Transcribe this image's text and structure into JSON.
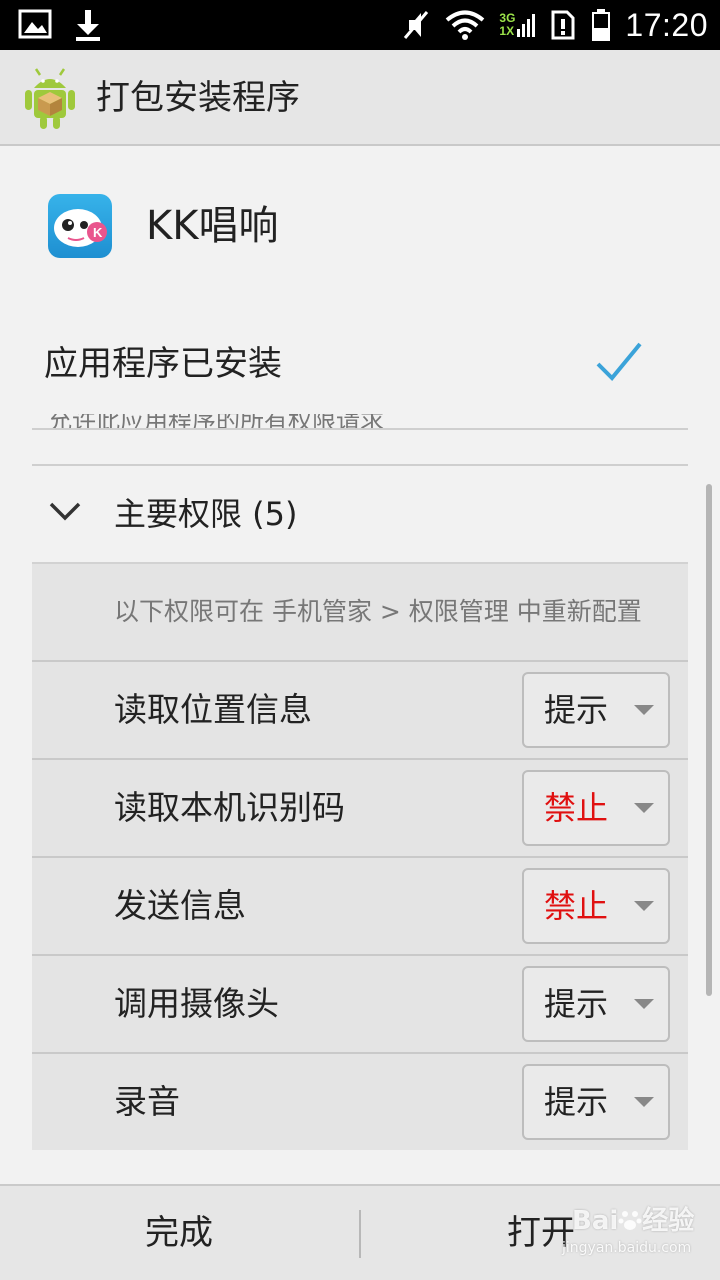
{
  "status_bar": {
    "time": "17:20",
    "network_top": "3G",
    "network_bottom": "1X",
    "icons": [
      "image-icon",
      "download-icon",
      "mute-icon",
      "wifi-icon",
      "signal-icon",
      "sim-alert-icon",
      "battery-icon"
    ]
  },
  "titlebar": {
    "title": "打包安装程序",
    "icon": "android-icon"
  },
  "app": {
    "name": "KK唱响",
    "icon": "kk-app-icon"
  },
  "install_status": {
    "text": "应用程序已安装",
    "icon": "checkmark-icon",
    "accent": "#3ba3d9"
  },
  "faded_text": "允许此应用程序的所有权限请求",
  "permissions": {
    "header": "主要权限 (5)",
    "note": "以下权限可在 手机管家 > 权限管理 中重新配置",
    "items": [
      {
        "label": "读取位置信息",
        "value": "提示",
        "color": "#222222"
      },
      {
        "label": "读取本机识别码",
        "value": "禁止",
        "color": "#e01010"
      },
      {
        "label": "发送信息",
        "value": "禁止",
        "color": "#e01010"
      },
      {
        "label": "调用摄像头",
        "value": "提示",
        "color": "#222222"
      },
      {
        "label": "录音",
        "value": "提示",
        "color": "#222222"
      }
    ]
  },
  "buttons": {
    "done": "完成",
    "open": "打开"
  },
  "watermark": {
    "brand": "Bai",
    "brand_cn": "经验",
    "url": "jingyan.baidu.com"
  }
}
